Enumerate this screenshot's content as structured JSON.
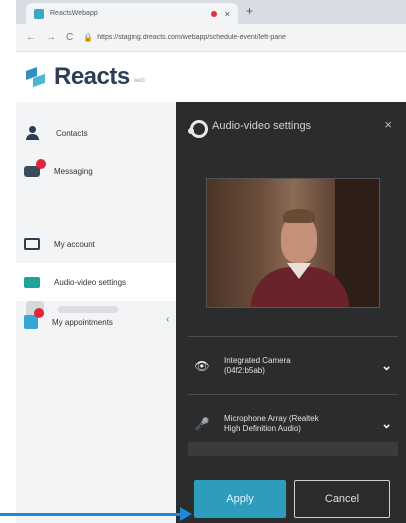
{
  "browser": {
    "tab_title": "ReactsWebapp",
    "tab_close": "×",
    "new_tab": "+",
    "nav_back": "←",
    "nav_forward": "→",
    "nav_reload": "C",
    "lock": "🔒",
    "url": "https://staging.dreacts.com/webapp/schedule-event/left-pane"
  },
  "app": {
    "brand": "Reacts",
    "brand_sub": "web"
  },
  "sidebar": {
    "items": [
      {
        "label": "Contacts"
      },
      {
        "label": "Messaging"
      },
      {
        "label": ""
      },
      {
        "label": "My account"
      },
      {
        "label": "Audio-video settings"
      },
      {
        "label": "My appointments"
      }
    ],
    "collapse": "‹"
  },
  "panel": {
    "title": "Audio-video settings",
    "close": "×",
    "camera_label": "Integrated Camera\n(04f2:b5ab)",
    "microphone_label": "Microphone Array (Realtek\nHigh Definition Audio)",
    "camera_icon": "eye-icon",
    "microphone_icon": "microphone-icon",
    "chevron": "⌄",
    "audio_level": 0.0,
    "apply_label": "Apply",
    "cancel_label": "Cancel"
  },
  "colors": {
    "accent": "#2d9cbd",
    "panel_bg": "#2b2c2e",
    "annotation_arrow": "#1e88d8",
    "badge": "#e1263a"
  }
}
